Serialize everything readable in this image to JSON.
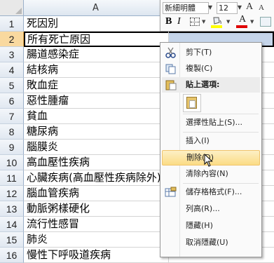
{
  "sheet": {
    "column_header": "A",
    "rows": [
      {
        "num": "1",
        "text": "死因別"
      },
      {
        "num": "2",
        "text": "所有死亡原因"
      },
      {
        "num": "3",
        "text": "腸道感染症"
      },
      {
        "num": "4",
        "text": "結核病"
      },
      {
        "num": "5",
        "text": "敗血症"
      },
      {
        "num": "6",
        "text": "惡性腫瘤"
      },
      {
        "num": "7",
        "text": "貧血"
      },
      {
        "num": "8",
        "text": "糖尿病"
      },
      {
        "num": "9",
        "text": "腦膜炎"
      },
      {
        "num": "10",
        "text": "高血壓性疾病"
      },
      {
        "num": "11",
        "text": "心臟疾病(高血壓性疾病除外)"
      },
      {
        "num": "12",
        "text": "腦血管疾病"
      },
      {
        "num": "13",
        "text": "動脈粥樣硬化"
      },
      {
        "num": "14",
        "text": "流行性感冒"
      },
      {
        "num": "15",
        "text": "肺炎"
      },
      {
        "num": "16",
        "text": "慢性下呼吸道疾病"
      }
    ],
    "selected_row": "2"
  },
  "mini_toolbar": {
    "font_name": "新細明體",
    "font_size": "12",
    "grow_label": "A",
    "shrink_label": "A",
    "bold_label": "B",
    "italic_label": "I",
    "font_color_label": "A",
    "fill_color": "#ffff00",
    "font_color": "#e00000"
  },
  "context_menu": {
    "cut": "剪下(T)",
    "copy": "複製(C)",
    "paste_options_header": "貼上選項:",
    "paste_special": "選擇性貼上(S)...",
    "insert": "插入(I)",
    "delete": "刪除(D)",
    "clear_contents": "清除內容(N)",
    "format_cells": "儲存格格式(F)...",
    "row_height": "列高(R)...",
    "hide": "隱藏(H)",
    "unhide": "取消隱藏(U)",
    "hovered_item": "delete"
  },
  "colors": {
    "selection_band": "#c5d5ea",
    "selected_row_header": "#f9d99f",
    "menu_hover": "#fbdc85"
  }
}
